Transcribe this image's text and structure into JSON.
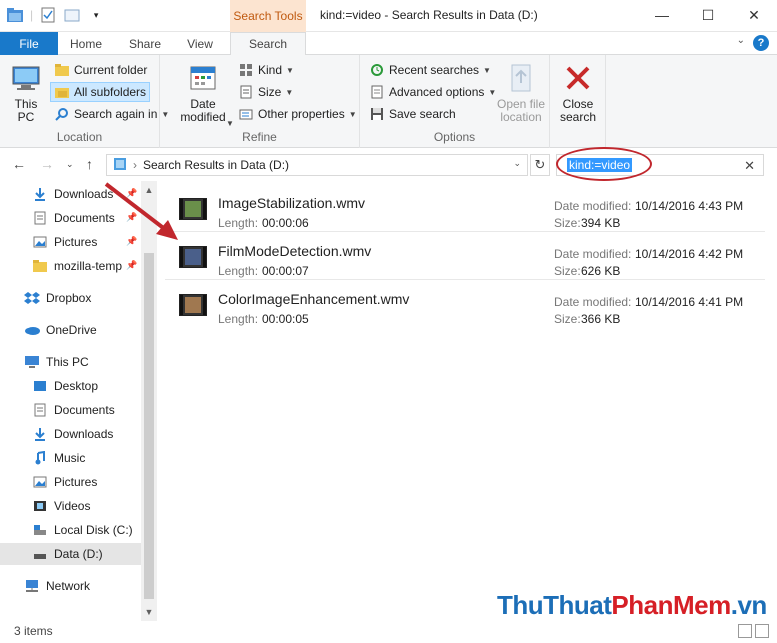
{
  "window": {
    "title": "kind:=video - Search Results in Data (D:)",
    "context_tab": "Search Tools",
    "minimize": "—",
    "maximize": "☐",
    "close": "✕"
  },
  "tabs": {
    "file": "File",
    "home": "Home",
    "share": "Share",
    "view": "View",
    "search": "Search",
    "expand": "⌄",
    "help": "?"
  },
  "ribbon": {
    "location": {
      "label": "Location",
      "this_pc": "This\nPC",
      "current_folder": "Current folder",
      "all_subfolders": "All subfolders",
      "search_again_in": "Search again in"
    },
    "refine": {
      "label": "Refine",
      "date_modified": "Date\nmodified",
      "kind": "Kind",
      "size": "Size",
      "other_properties": "Other properties"
    },
    "options": {
      "label": "Options",
      "recent_searches": "Recent searches",
      "advanced_options": "Advanced options",
      "save_search": "Save search",
      "open_file_location": "Open file\nlocation",
      "close_search": "Close\nsearch"
    }
  },
  "address": {
    "path": "Search Results in Data (D:)",
    "search_query": "kind:=video"
  },
  "nav": {
    "quick_access": [
      {
        "label": "Downloads",
        "icon": "download-icon"
      },
      {
        "label": "Documents",
        "icon": "documents-icon"
      },
      {
        "label": "Pictures",
        "icon": "pictures-icon"
      },
      {
        "label": "mozilla-temp",
        "icon": "folder-icon"
      }
    ],
    "dropbox": "Dropbox",
    "onedrive": "OneDrive",
    "this_pc": "This PC",
    "pc_items": [
      {
        "label": "Desktop",
        "icon": "desktop-icon"
      },
      {
        "label": "Documents",
        "icon": "documents-icon"
      },
      {
        "label": "Downloads",
        "icon": "download-icon"
      },
      {
        "label": "Music",
        "icon": "music-icon"
      },
      {
        "label": "Pictures",
        "icon": "pictures-icon"
      },
      {
        "label": "Videos",
        "icon": "videos-icon"
      },
      {
        "label": "Local Disk (C:)",
        "icon": "drive-c-icon"
      },
      {
        "label": "Data (D:)",
        "icon": "drive-d-icon"
      }
    ],
    "network": "Network"
  },
  "results": [
    {
      "name": "ImageStabilization.wmv",
      "length_label": "Length:",
      "length": "00:00:06",
      "date_label": "Date modified:",
      "date": "10/14/2016 4:43 PM",
      "size_label": "Size:",
      "size": "394 KB"
    },
    {
      "name": "FilmModeDetection.wmv",
      "length_label": "Length:",
      "length": "00:00:07",
      "date_label": "Date modified:",
      "date": "10/14/2016 4:42 PM",
      "size_label": "Size:",
      "size": "626 KB"
    },
    {
      "name": "ColorImageEnhancement.wmv",
      "length_label": "Length:",
      "length": "00:00:05",
      "date_label": "Date modified:",
      "date": "10/14/2016 4:41 PM",
      "size_label": "Size:",
      "size": "366 KB"
    }
  ],
  "status": {
    "count": "3 items"
  },
  "watermark": {
    "part1": "ThuThuat",
    "part2": "PhanMem",
    "part3": ".vn"
  },
  "colors": {
    "accent": "#1979ca",
    "context_tab_bg": "#fce4d0",
    "annotation_red": "#c1272d"
  }
}
